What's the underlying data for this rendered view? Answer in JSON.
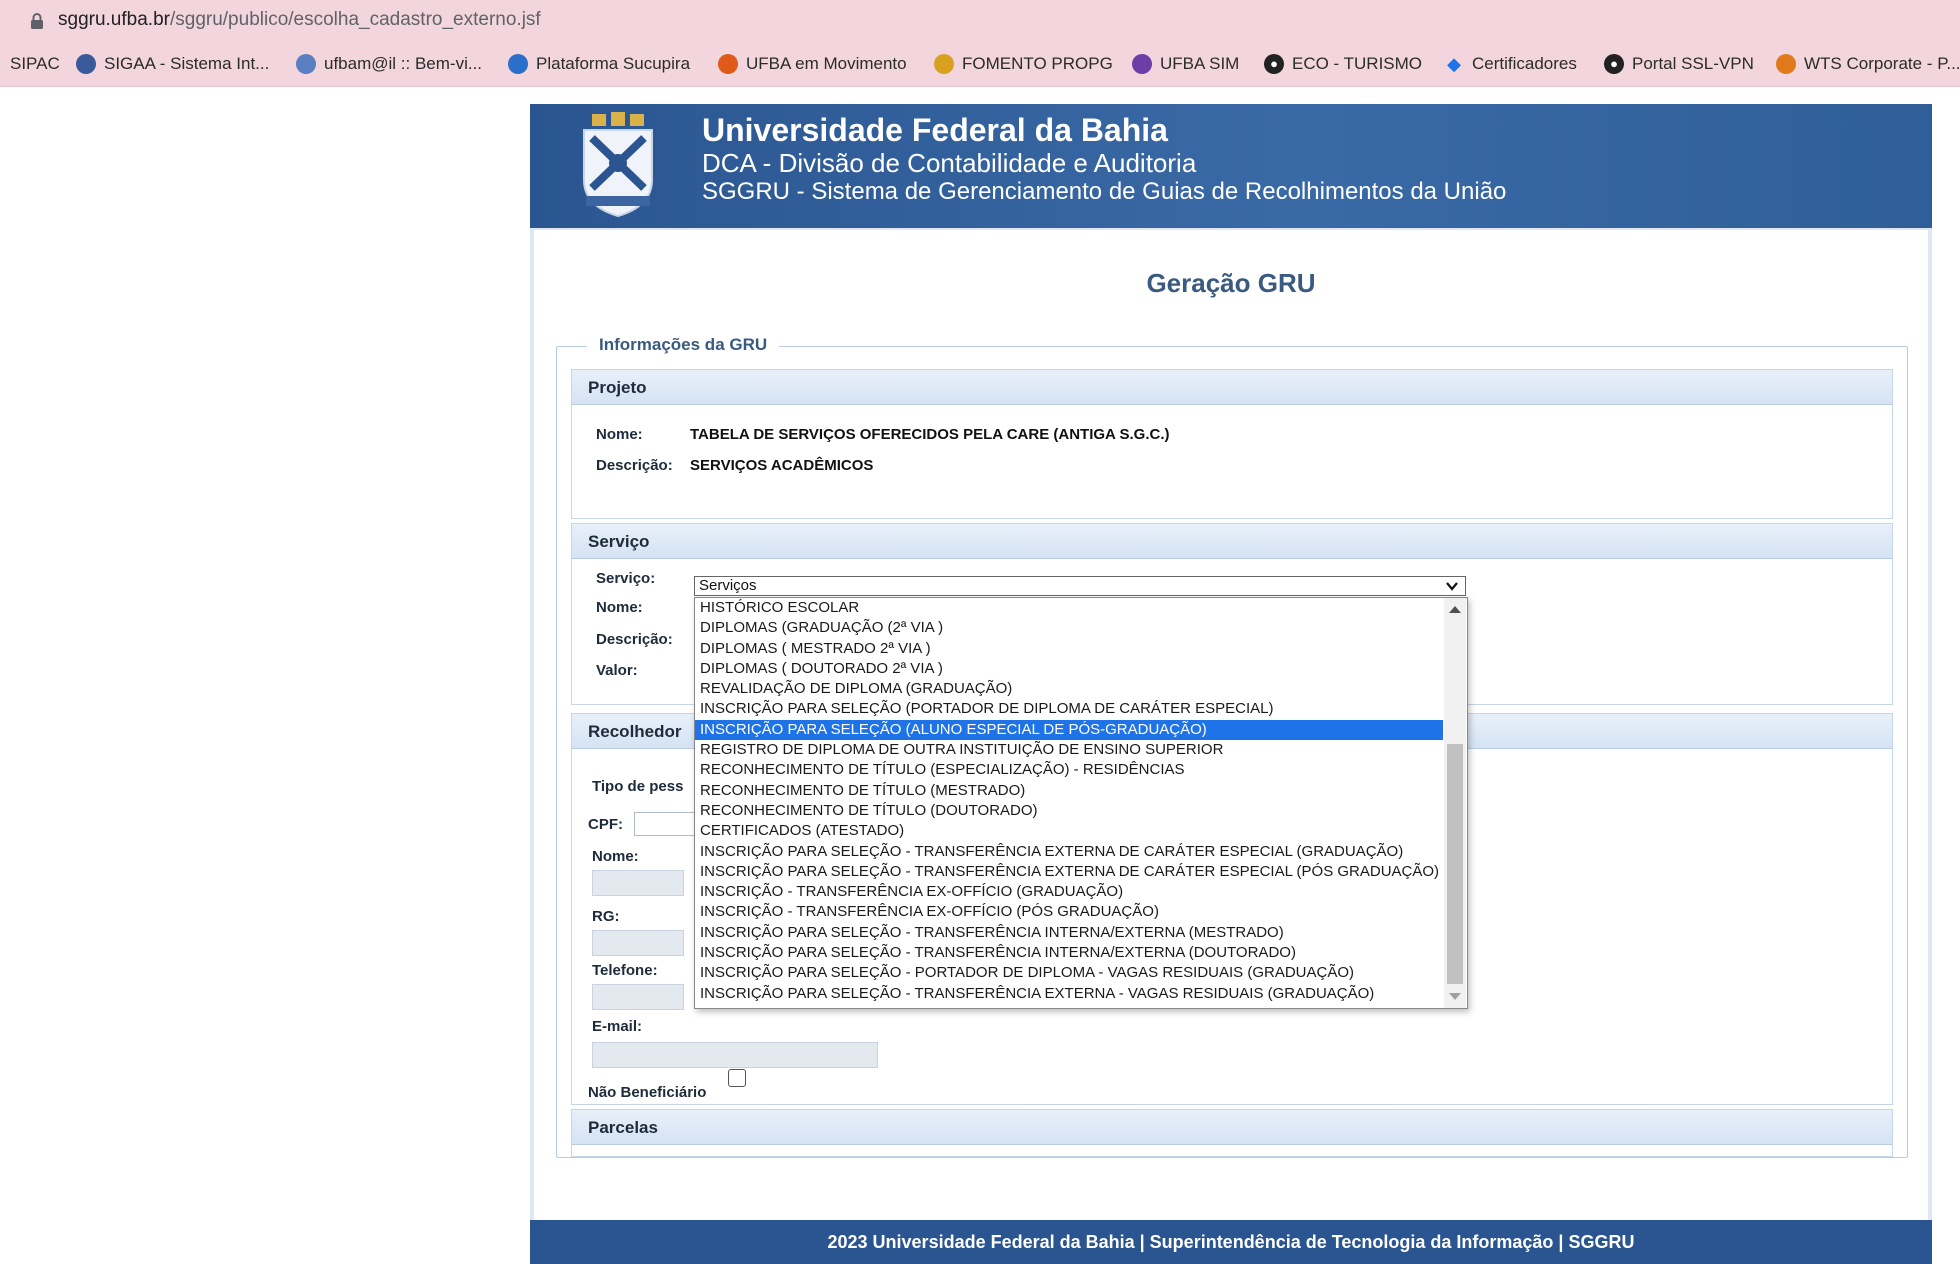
{
  "browser": {
    "url_host": "sggru.ufba.br",
    "url_path": "/sggru/publico/escolha_cadastro_externo.jsf",
    "bookmarks": [
      {
        "label": "SIPAC",
        "icon": "none",
        "color": "#000000"
      },
      {
        "label": "SIGAA - Sistema Int...",
        "icon": "sigaa-icon",
        "color": "#3b5a9a"
      },
      {
        "label": "ufbam@il :: Bem-vi...",
        "icon": "ufbamail-icon",
        "color": "#5a7fc0"
      },
      {
        "label": "Plataforma Sucupira",
        "icon": "sucupira-icon",
        "color": "#2a6fc9"
      },
      {
        "label": "UFBA em Movimento",
        "icon": "ufba-movimento-icon",
        "color": "#e05a1a"
      },
      {
        "label": "FOMENTO PROPG",
        "icon": "fomento-icon",
        "color": "#d9a020"
      },
      {
        "label": "UFBA SIM",
        "icon": "ufba-sim-icon",
        "color": "#6b3ea8"
      },
      {
        "label": "ECO - TURISMO",
        "icon": "globe-icon",
        "color": "#222222"
      },
      {
        "label": "Certificadores",
        "icon": "diamond-icon",
        "color": "#1e73e8"
      },
      {
        "label": "Portal SSL-VPN",
        "icon": "globe-icon",
        "color": "#222222"
      },
      {
        "label": "WTS Corporate - P...",
        "icon": "wts-icon",
        "color": "#e07a1a"
      }
    ]
  },
  "header": {
    "university": "Universidade Federal da Bahia",
    "division": "DCA - Divisão de Contabilidade e Auditoria",
    "system": "SGGRU - Sistema de Gerenciamento de Guias de Recolhimentos da União"
  },
  "page": {
    "title": "Geração GRU",
    "fieldset_legend": "Informações da GRU"
  },
  "projeto": {
    "heading": "Projeto",
    "nome_label": "Nome:",
    "nome_value": "TABELA DE SERVIÇOS OFERECIDOS PELA CARE (ANTIGA S.G.C.)",
    "descricao_label": "Descrição:",
    "descricao_value": "SERVIÇOS ACADÊMICOS"
  },
  "servico": {
    "heading": "Serviço",
    "servico_label": "Serviço:",
    "nome_label": "Nome:",
    "descricao_label": "Descrição:",
    "valor_label": "Valor:",
    "select_value": "Serviços",
    "selected_index": 6,
    "options": [
      "HISTÓRICO ESCOLAR",
      "DIPLOMAS (GRADUAÇÃO (2ª VIA )",
      "DIPLOMAS ( MESTRADO 2ª VIA )",
      "DIPLOMAS ( DOUTORADO 2ª VIA )",
      "REVALIDAÇÃO DE DIPLOMA (GRADUAÇÃO)",
      "INSCRIÇÃO PARA SELEÇÃO (PORTADOR DE DIPLOMA DE CARÁTER ESPECIAL)",
      "INSCRIÇÃO PARA SELEÇÃO (ALUNO ESPECIAL DE PÓS-GRADUAÇÃO)",
      "REGISTRO DE DIPLOMA DE OUTRA INSTITUIÇÃO DE ENSINO SUPERIOR",
      "RECONHECIMENTO DE TÍTULO (ESPECIALIZAÇÃO) - RESIDÊNCIAS",
      "RECONHECIMENTO DE TÍTULO (MESTRADO)",
      "RECONHECIMENTO DE TÍTULO (DOUTORADO)",
      "CERTIFICADOS (ATESTADO)",
      "INSCRIÇÃO PARA SELEÇÃO - TRANSFERÊNCIA EXTERNA DE CARÁTER ESPECIAL (GRADUAÇÃO)",
      "INSCRIÇÃO PARA SELEÇÃO - TRANSFERÊNCIA EXTERNA DE CARÁTER ESPECIAL (PÓS GRADUAÇÃO)",
      "INSCRIÇÃO - TRANSFERÊNCIA EX-OFFÍCIO (GRADUAÇÃO)",
      "INSCRIÇÃO - TRANSFERÊNCIA EX-OFFÍCIO (PÓS GRADUAÇÃO)",
      "INSCRIÇÃO PARA SELEÇÃO - TRANSFERÊNCIA INTERNA/EXTERNA (MESTRADO)",
      "INSCRIÇÃO PARA SELEÇÃO - TRANSFERÊNCIA INTERNA/EXTERNA (DOUTORADO)",
      "INSCRIÇÃO PARA SELEÇÃO - PORTADOR DE DIPLOMA - VAGAS RESIDUAIS (GRADUAÇÃO)",
      "INSCRIÇÃO PARA SELEÇÃO - TRANSFERÊNCIA EXTERNA - VAGAS RESIDUAIS (GRADUAÇÃO)"
    ]
  },
  "recolhedor": {
    "heading": "Recolhedor",
    "tipo_label": "Tipo de pess",
    "cpf_label": "CPF:",
    "nome_label": "Nome:",
    "rg_label": "RG:",
    "telefone_label": "Telefone:",
    "email_label": "E-mail:",
    "nao_beneficiario_label": "Não Beneficiário"
  },
  "parcelas": {
    "heading": "Parcelas"
  },
  "footer": {
    "text_main": "2023 Universidade Federal da Bahia | Superintendência de Tecnologia da Informação | ",
    "text_bold": "SGGRU"
  }
}
